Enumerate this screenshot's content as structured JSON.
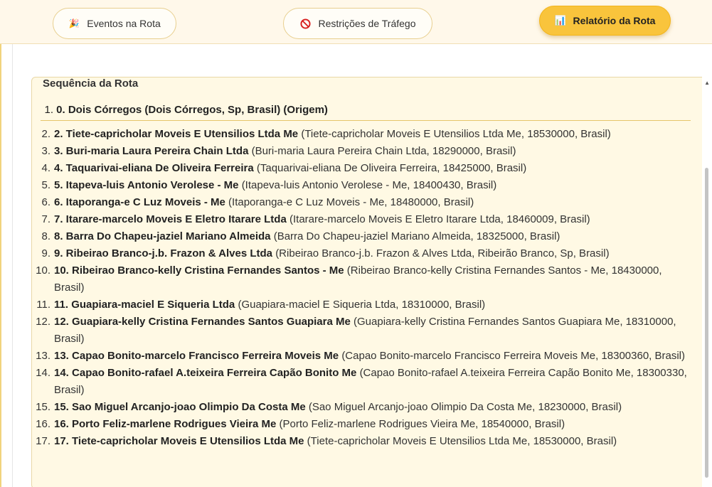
{
  "tabs": [
    {
      "label": "Eventos na Rota",
      "icon": "party-popper-icon",
      "glyph": "🎉"
    },
    {
      "label": "Restrições de Tráfego",
      "icon": "no-entry-icon",
      "glyph": ""
    },
    {
      "label": "Relatório da Rota",
      "icon": "bar-chart-icon",
      "glyph": "📊"
    }
  ],
  "panel": {
    "title": "Sequência da Rota",
    "origin": {
      "num": "1.",
      "name": "0. Dois Córregos",
      "detail": "(Dois Córregos, Sp, Brasil) (Origem)"
    },
    "stops": [
      {
        "num": "2.",
        "name": "2. Tiete-capricholar Moveis E Utensilios Ltda Me",
        "detail": "(Tiete-capricholar Moveis E Utensilios Ltda Me, 18530000, Brasil)"
      },
      {
        "num": "3.",
        "name": "3. Buri-maria Laura Pereira Chain Ltda",
        "detail": "(Buri-maria Laura Pereira Chain Ltda, 18290000, Brasil)"
      },
      {
        "num": "4.",
        "name": "4. Taquarivai-eliana De Oliveira Ferreira",
        "detail": "(Taquarivai-eliana De Oliveira Ferreira, 18425000, Brasil)"
      },
      {
        "num": "5.",
        "name": "5. Itapeva-luis Antonio Verolese - Me",
        "detail": "(Itapeva-luis Antonio Verolese - Me, 18400430, Brasil)"
      },
      {
        "num": "6.",
        "name": "6. Itaporanga-e C Luz Moveis - Me",
        "detail": "(Itaporanga-e C Luz Moveis - Me, 18480000, Brasil)"
      },
      {
        "num": "7.",
        "name": "7. Itarare-marcelo Moveis E Eletro Itarare Ltda",
        "detail": "(Itarare-marcelo Moveis E Eletro Itarare Ltda, 18460009, Brasil)"
      },
      {
        "num": "8.",
        "name": "8. Barra Do Chapeu-jaziel Mariano Almeida",
        "detail": "(Barra Do Chapeu-jaziel Mariano Almeida, 18325000, Brasil)"
      },
      {
        "num": "9.",
        "name": "9. Ribeirao Branco-j.b. Frazon & Alves Ltda",
        "detail": "(Ribeirao Branco-j.b. Frazon & Alves Ltda, Ribeirão Branco, Sp, Brasil)"
      },
      {
        "num": "10.",
        "name": "10. Ribeirao Branco-kelly Cristina Fernandes Santos - Me",
        "detail": "(Ribeirao Branco-kelly Cristina Fernandes Santos - Me, 18430000, Brasil)"
      },
      {
        "num": "11.",
        "name": "11. Guapiara-maciel E Siqueria Ltda",
        "detail": "(Guapiara-maciel E Siqueria Ltda, 18310000, Brasil)"
      },
      {
        "num": "12.",
        "name": "12. Guapiara-kelly Cristina Fernandes Santos Guapiara Me",
        "detail": "(Guapiara-kelly Cristina Fernandes Santos Guapiara Me, 18310000, Brasil)"
      },
      {
        "num": "13.",
        "name": "13. Capao Bonito-marcelo Francisco Ferreira Moveis Me",
        "detail": "(Capao Bonito-marcelo Francisco Ferreira Moveis Me, 18300360, Brasil)"
      },
      {
        "num": "14.",
        "name": "14. Capao Bonito-rafael A.teixeira Ferreira Capão Bonito Me",
        "detail": "(Capao Bonito-rafael A.teixeira Ferreira Capão Bonito Me, 18300330, Brasil)"
      },
      {
        "num": "15.",
        "name": "15. Sao Miguel Arcanjo-joao Olimpio Da Costa Me",
        "detail": "(Sao Miguel Arcanjo-joao Olimpio Da Costa Me, 18230000, Brasil)"
      },
      {
        "num": "16.",
        "name": "16. Porto Feliz-marlene Rodrigues Vieira Me",
        "detail": "(Porto Feliz-marlene Rodrigues Vieira Me, 18540000, Brasil)"
      },
      {
        "num": "17.",
        "name": "17. Tiete-capricholar Moveis E Utensilios Ltda Me",
        "detail": "(Tiete-capricholar Moveis E Utensilios Ltda Me, 18530000, Brasil)"
      }
    ]
  },
  "colors": {
    "accent": "#f9c43c",
    "panel_bg": "#fff9e4",
    "topbar_bg": "#fff8ea"
  }
}
